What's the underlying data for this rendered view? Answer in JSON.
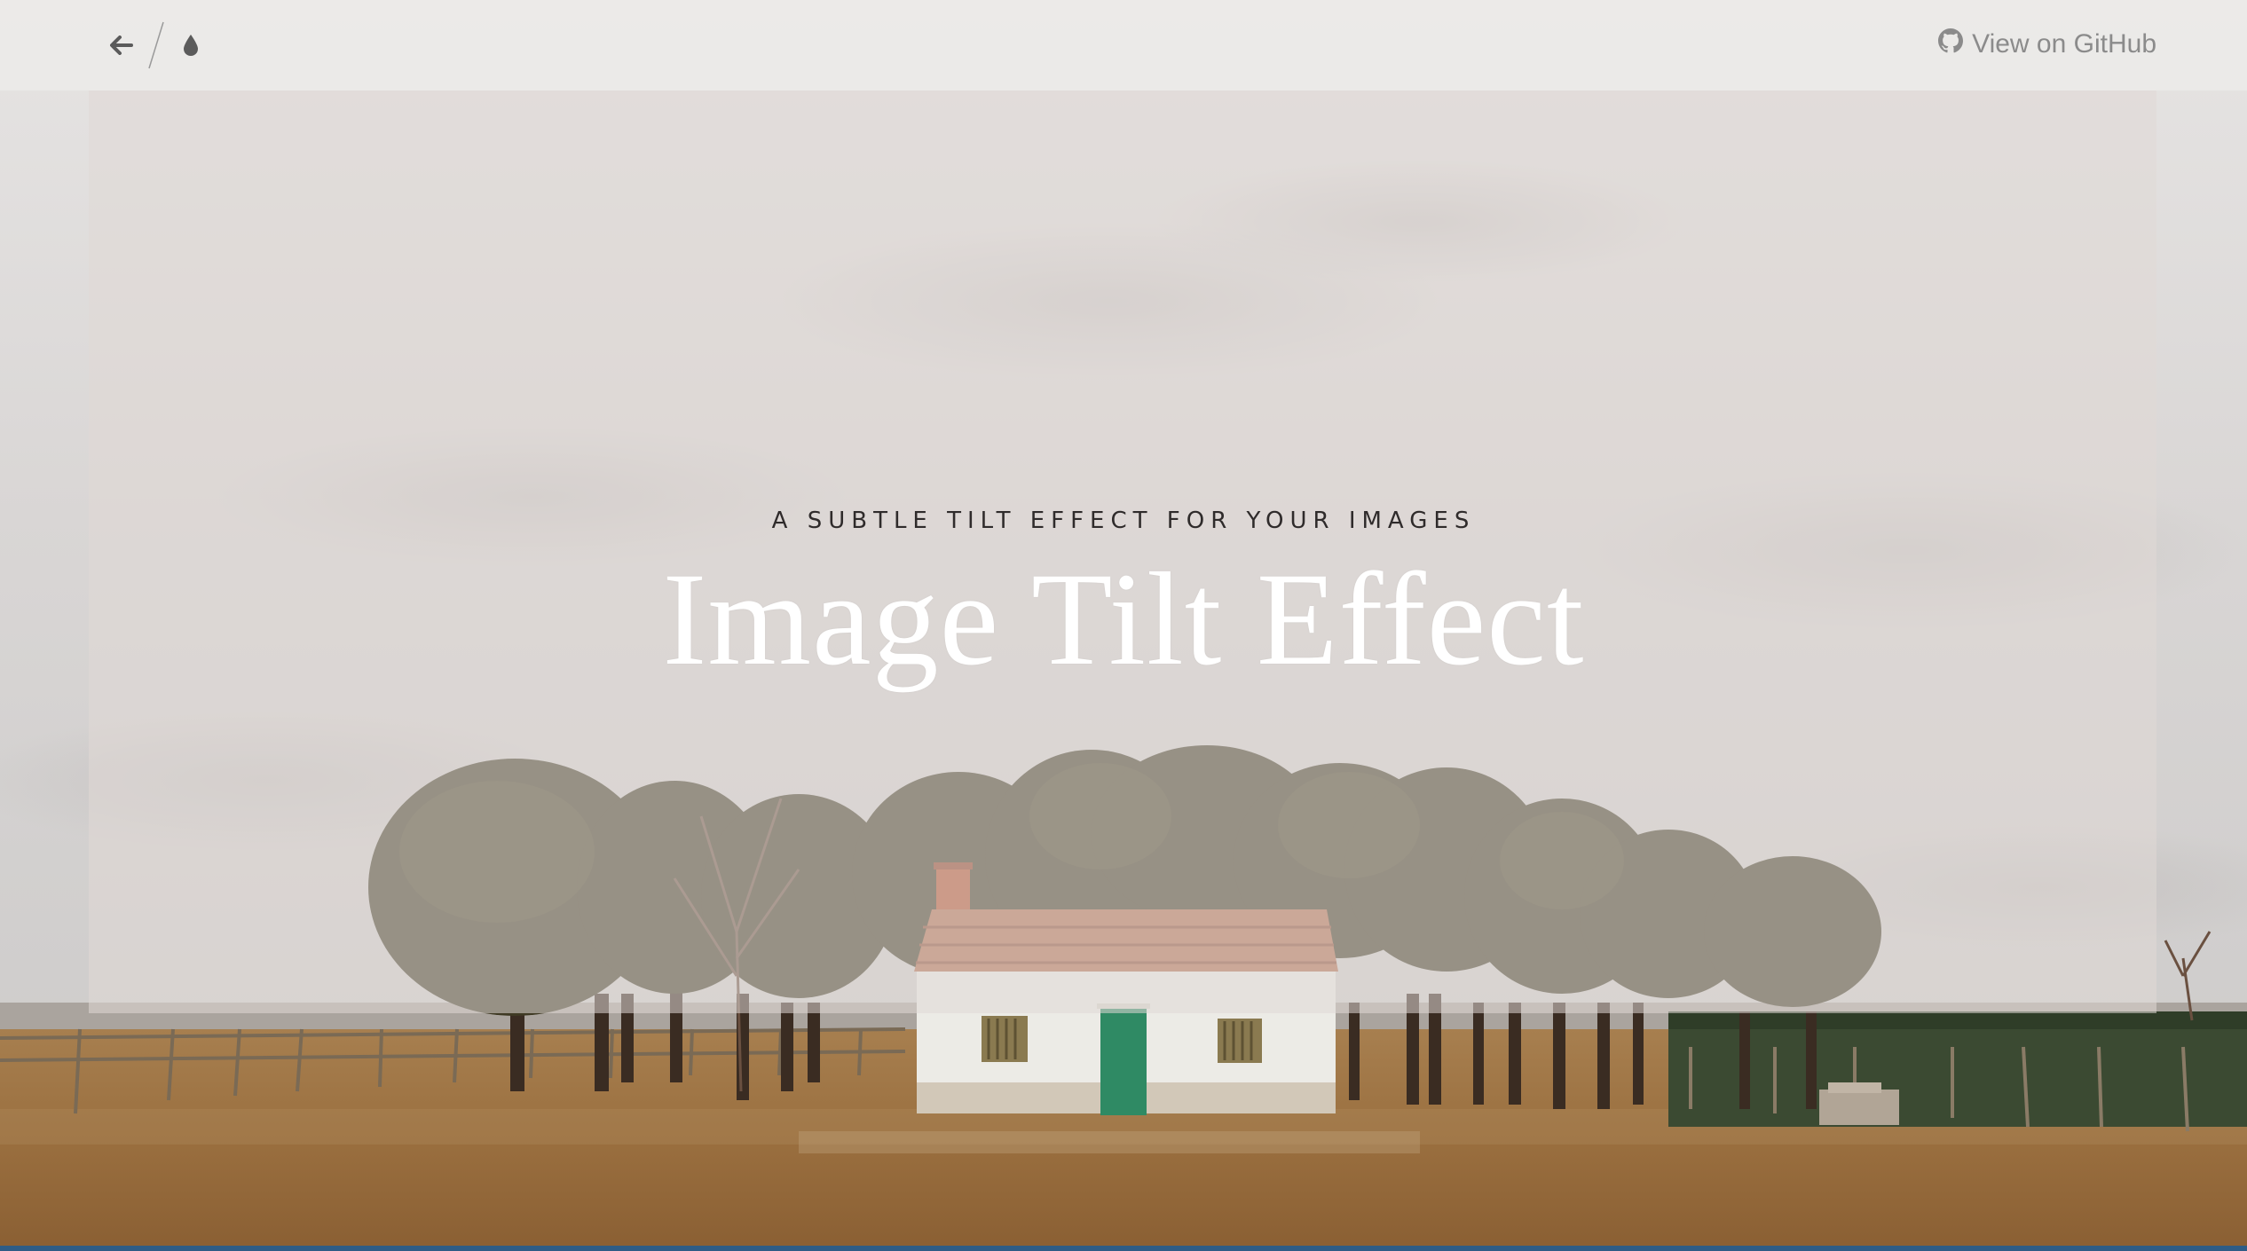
{
  "topbar": {
    "back_icon": "arrow-left-icon",
    "drop_icon": "droplet-icon",
    "github_icon": "github-icon",
    "github_label": "View on GitHub"
  },
  "hero": {
    "subtitle": "A SUBTLE TILT EFFECT FOR YOUR IMAGES",
    "title": "Image Tilt Effect"
  },
  "colors": {
    "title": "#ffffff",
    "subtitle": "#2f2b2b",
    "panel": "#e0d8d6",
    "link": "#8b8b8b",
    "door": "#2f8a64"
  }
}
